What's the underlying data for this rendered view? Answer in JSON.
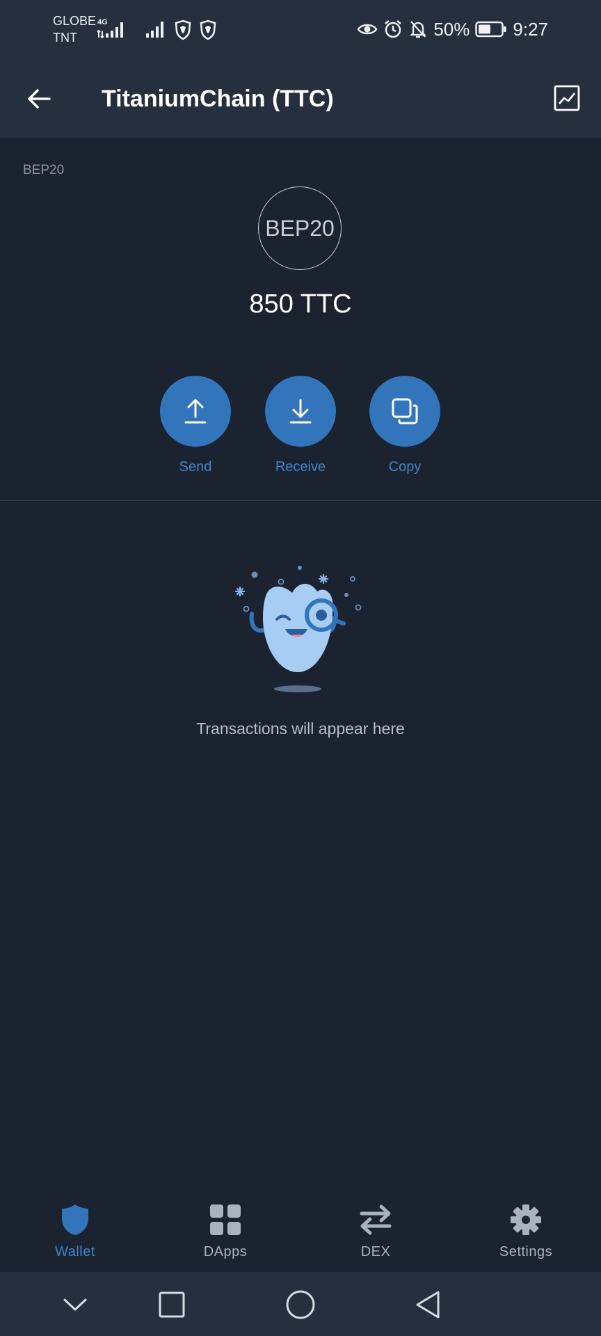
{
  "status_bar": {
    "carrier_1": "GLOBE",
    "carrier_2": "TNT",
    "network": "4G",
    "battery": "50%",
    "time": "9:27"
  },
  "app_bar": {
    "title": "TitaniumChain (TTC)"
  },
  "token": {
    "tag": "BEP20",
    "logo_text": "BEP20",
    "balance": "850 TTC"
  },
  "actions": [
    {
      "label": "Send"
    },
    {
      "label": "Receive"
    },
    {
      "label": "Copy"
    }
  ],
  "empty_state": {
    "message": "Transactions will appear here"
  },
  "bottom_nav": [
    {
      "label": "Wallet",
      "active": true
    },
    {
      "label": "DApps"
    },
    {
      "label": "DEX"
    },
    {
      "label": "Settings"
    }
  ],
  "colors": {
    "background": "#1b2230",
    "bar": "#252f3e",
    "accent": "#3375bb",
    "accent_text": "#3f86cc"
  }
}
